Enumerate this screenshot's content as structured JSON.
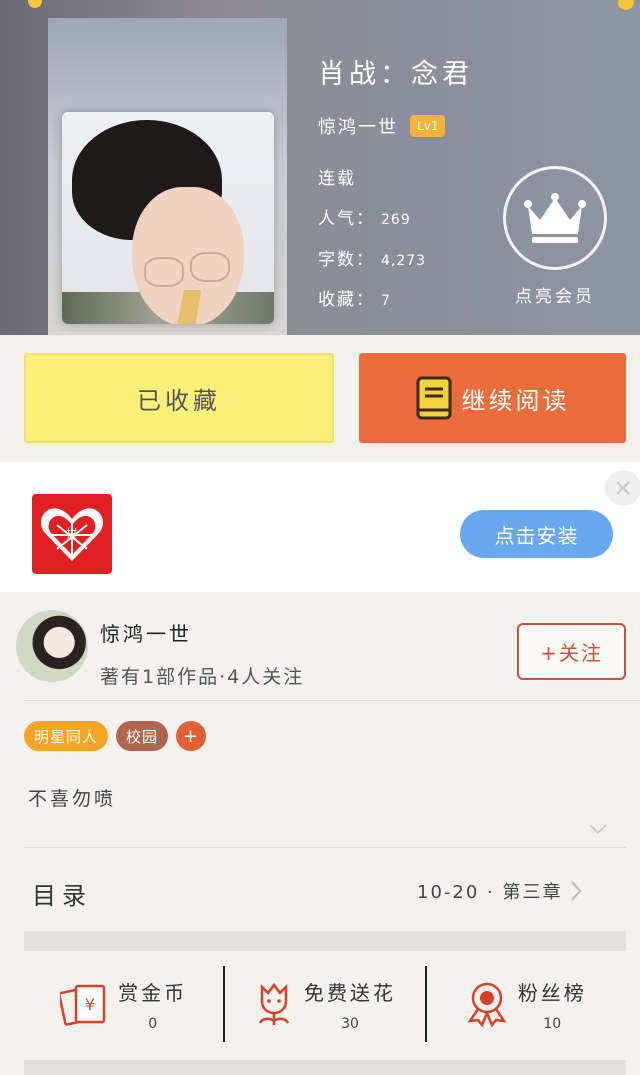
{
  "book": {
    "title": "肖战：念君",
    "author": "惊鸿一世",
    "level_badge": "Lv1",
    "status": "连载",
    "popularity_label": "人气：",
    "popularity": "269",
    "words_label": "字数：",
    "words": "4,273",
    "favorites_label": "收藏：",
    "favorites": "7",
    "vip_label": "点亮会员"
  },
  "actions": {
    "favorited_label": "已收藏",
    "continue_label": "继续阅读"
  },
  "ad": {
    "install_label": "点击安装"
  },
  "author": {
    "name": "惊鸿一世",
    "subtitle": "著有1部作品·4人关注",
    "follow_label": "+关注"
  },
  "tags": [
    "明星同人",
    "校园",
    "+"
  ],
  "description": "不喜勿喷",
  "toc": {
    "label": "目录",
    "latest": "10-20 · 第三章"
  },
  "stats": [
    {
      "label": "赏金币",
      "value": "0",
      "icon": "money-envelope-icon"
    },
    {
      "label": "免费送花",
      "value": "30",
      "icon": "flower-icon"
    },
    {
      "label": "粉丝榜",
      "value": "10",
      "icon": "medal-icon"
    }
  ],
  "colors": {
    "favorite_bg": "#fbf17a",
    "read_bg": "#ec6c3b",
    "install_bg": "#6aa8ee",
    "follow_border": "#c9523a",
    "icon_red": "#d8402a"
  }
}
